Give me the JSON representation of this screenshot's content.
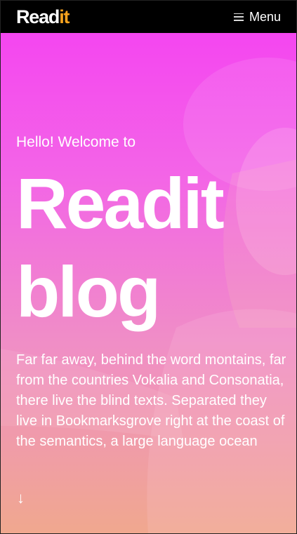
{
  "navbar": {
    "brand_main": "Read",
    "brand_accent": "it",
    "menu_label": "Menu",
    "menu_icon": "hamburger-icon"
  },
  "hero": {
    "greeting": "Hello! Welcome to",
    "title_line1": "Readit",
    "title_line2": "blog",
    "intro": "Far far away, behind the word montains, far from the countries Vokalia and Consonatia, there live the blind texts. Separated they live in Bookmarksgrove right at the coast of the semantics, a large language ocean",
    "scroll_icon": "arrow-down-icon",
    "scroll_glyph": "↓"
  },
  "colors": {
    "navbar_bg": "#000000",
    "brand_accent": "#f7a21e",
    "hero_gradient_top": "#f446f0",
    "hero_gradient_bottom": "#f0a88e"
  }
}
